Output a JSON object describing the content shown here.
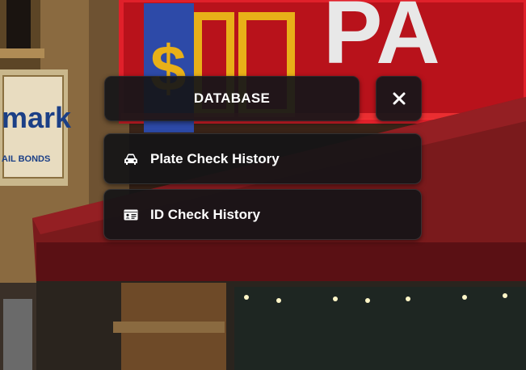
{
  "header": {
    "title": "DATABASE",
    "close_icon": "close-icon"
  },
  "menu": {
    "items": [
      {
        "label": "Plate Check History",
        "icon": "car-icon"
      },
      {
        "label": "ID Check History",
        "icon": "id-card-icon"
      }
    ]
  },
  "background": {
    "signs": {
      "left_sign_text": "mark",
      "left_sign_subtext": "AIL BONDS",
      "right_sign_text": "PA"
    }
  },
  "colors": {
    "panel_bg": "#161619",
    "text": "#ffffff",
    "awning": "#7a1a1c",
    "sign_red": "#c8141c"
  }
}
